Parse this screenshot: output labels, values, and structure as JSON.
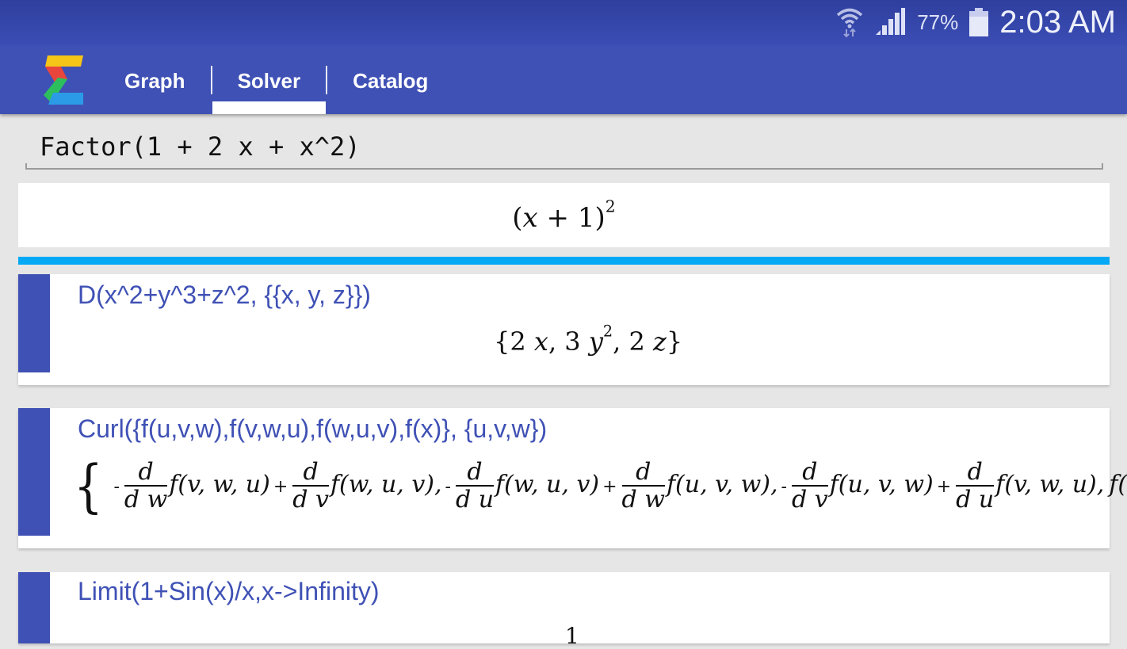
{
  "status_bar": {
    "wifi_icon": "wifi-icon",
    "signal_icon": "cellular-signal-icon",
    "battery_percent": "77%",
    "battery_level": 0.77,
    "battery_icon": "battery-icon",
    "time": "2:03 AM"
  },
  "app": {
    "logo_icon": "sigma-logo-icon",
    "tabs": [
      {
        "label": "Graph",
        "active": false
      },
      {
        "label": "Solver",
        "active": true
      },
      {
        "label": "Catalog",
        "active": false
      }
    ]
  },
  "input": {
    "value": "Factor(1 + 2 x + x^2)"
  },
  "current_result": {
    "text": "(x + 1)^2",
    "open": "(",
    "var": "x",
    "op": "+",
    "num": "1",
    "close": ")",
    "exp": "2"
  },
  "colors": {
    "primary": "#3f51b5",
    "accent": "#03a9f4",
    "background": "#e6e6e6"
  },
  "history": [
    {
      "query": "D(x^2+y^3+z^2, {{x, y, z}})",
      "result": "{2 x, 3 y^2, 2 z}",
      "parts": {
        "a": "{2",
        "x": "x",
        "b": ", 3",
        "y": "y",
        "exp": "2",
        "c": ", 2",
        "z": "z",
        "d": "}"
      }
    },
    {
      "query": "Curl({f(u,v,w),f(v,w,u),f(w,u,v),f(x)}, {u,v,w})",
      "result": "{ -d/dw f(v, w, u) + d/dv f(w, u, v), -d/du f(w, u, v) + d/dw f(u, v, w), -d/dv f(u, v, w) + d/du f(v, w, u), f(x) }",
      "terms": [
        {
          "sign": "-",
          "num": "d",
          "den": "d w",
          "fn": "f(v, w, u)"
        },
        {
          "sign": "+",
          "num": "d",
          "den": "d v",
          "fn": "f(w, u, v),"
        },
        {
          "sign": "-",
          "num": "d",
          "den": "d u",
          "fn": "f(w, u, v)"
        },
        {
          "sign": "+",
          "num": "d",
          "den": "d w",
          "fn": "f(u, v, w),"
        },
        {
          "sign": "-",
          "num": "d",
          "den": "d v",
          "fn": "f(u, v, w)"
        },
        {
          "sign": "+",
          "num": "d",
          "den": "d u",
          "fn": "f(v, w, u),"
        }
      ],
      "tail": "f(x)",
      "open": "{",
      "close": "}"
    },
    {
      "query": "Limit(1+Sin(x)/x,x->Infinity)",
      "result": "1"
    }
  ]
}
